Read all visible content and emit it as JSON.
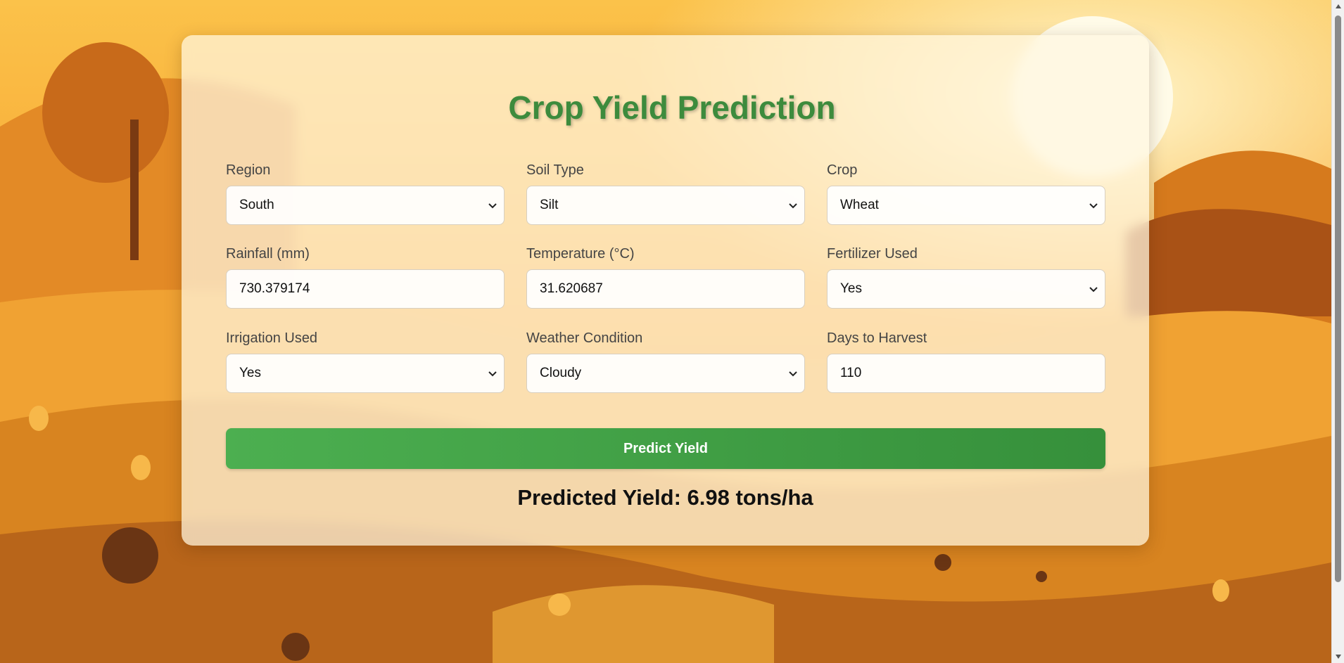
{
  "page": {
    "title": "Crop Yield Prediction"
  },
  "form": {
    "fields": [
      {
        "label": "Region",
        "type": "select",
        "value": "South"
      },
      {
        "label": "Soil Type",
        "type": "select",
        "value": "Silt"
      },
      {
        "label": "Crop",
        "type": "select",
        "value": "Wheat"
      },
      {
        "label": "Rainfall (mm)",
        "type": "input",
        "value": "730.379174"
      },
      {
        "label": "Temperature (°C)",
        "type": "input",
        "value": "31.620687"
      },
      {
        "label": "Fertilizer Used",
        "type": "select",
        "value": "Yes"
      },
      {
        "label": "Irrigation Used",
        "type": "select",
        "value": "Yes"
      },
      {
        "label": "Weather Condition",
        "type": "select",
        "value": "Cloudy"
      },
      {
        "label": "Days to Harvest",
        "type": "input",
        "value": "110"
      }
    ],
    "submit_label": "Predict Yield"
  },
  "result": {
    "text": "Predicted Yield: 6.98 tons/ha"
  },
  "colors": {
    "accent": "#4caf50",
    "title": "#3d8b3d"
  },
  "icons": {
    "select_arrow": "chevron-down-icon",
    "scroll_up": "scroll-up-arrow-icon",
    "scroll_down": "scroll-down-arrow-icon"
  }
}
